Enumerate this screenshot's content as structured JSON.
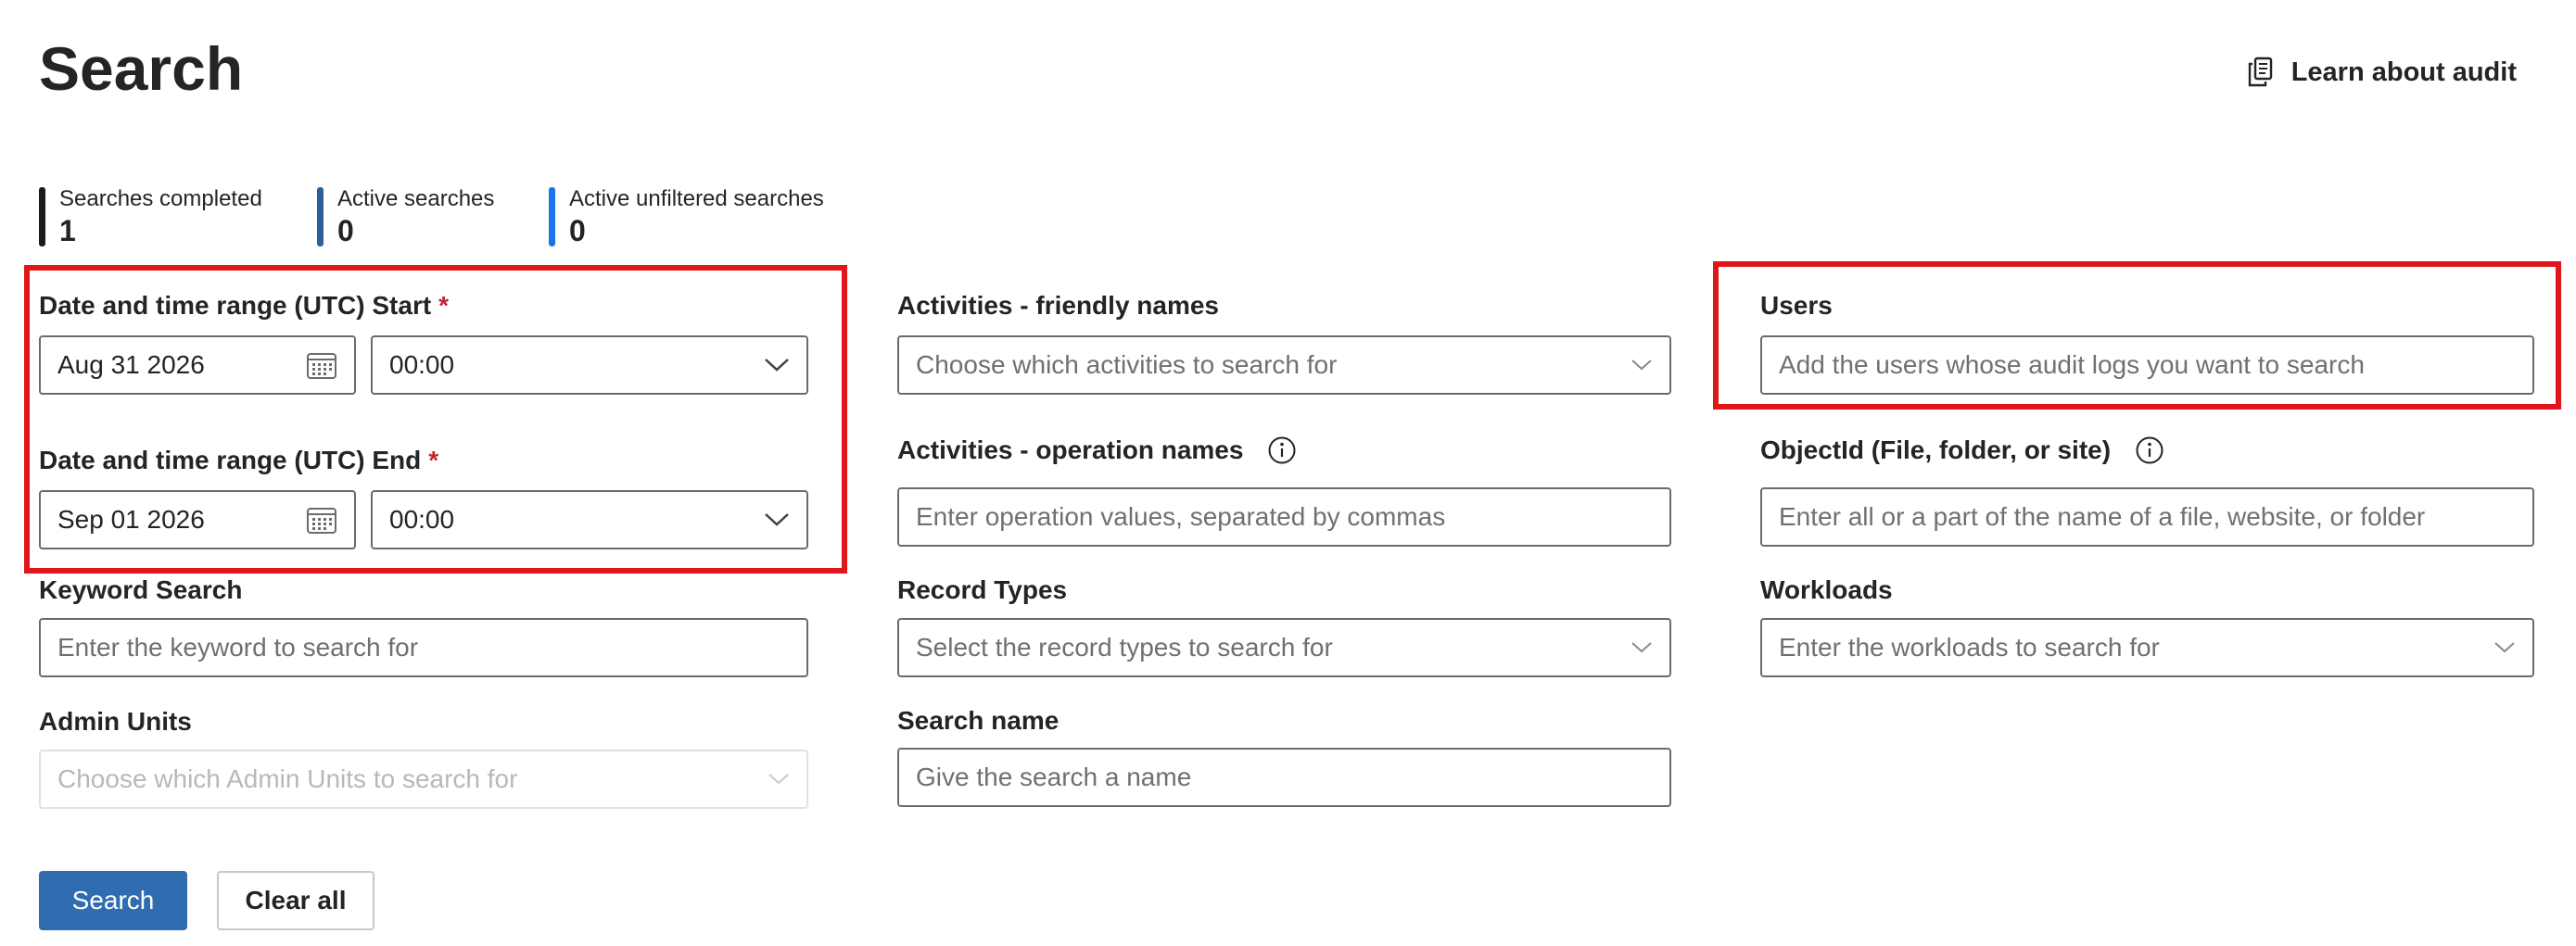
{
  "header": {
    "title": "Search",
    "learn_link": "Learn about audit"
  },
  "stats": [
    {
      "label": "Searches completed",
      "value": "1",
      "color": "#1b1b1b"
    },
    {
      "label": "Active searches",
      "value": "0",
      "color": "#2f5f97"
    },
    {
      "label": "Active unfiltered searches",
      "value": "0",
      "color": "#1a73e8"
    }
  ],
  "form": {
    "start": {
      "label": "Date and time range (UTC) Start",
      "required_mark": "*",
      "date": "Aug 31 2026",
      "time": "00:00"
    },
    "end": {
      "label": "Date and time range (UTC) End",
      "required_mark": "*",
      "date": "Sep 01 2026",
      "time": "00:00"
    },
    "activities_friendly": {
      "label": "Activities - friendly names",
      "placeholder": "Choose which activities to search for"
    },
    "activities_operation": {
      "label": "Activities - operation names",
      "placeholder": "Enter operation values, separated by commas"
    },
    "users": {
      "label": "Users",
      "placeholder": "Add the users whose audit logs you want to search"
    },
    "object_id": {
      "label": "ObjectId (File, folder, or site)",
      "placeholder": "Enter all or a part of the name of a file, website, or folder"
    },
    "keyword": {
      "label": "Keyword Search",
      "placeholder": "Enter the keyword to search for"
    },
    "record_types": {
      "label": "Record Types",
      "placeholder": "Select the record types to search for"
    },
    "workloads": {
      "label": "Workloads",
      "placeholder": "Enter the workloads to search for"
    },
    "admin_units": {
      "label": "Admin Units",
      "placeholder": "Choose which Admin Units to search for"
    },
    "search_name": {
      "label": "Search name",
      "placeholder": "Give the search a name"
    }
  },
  "actions": {
    "search": "Search",
    "clear_all": "Clear all"
  },
  "icons": {
    "calendar": "calendar-icon",
    "chevron": "chevron-down-icon",
    "info": "info-icon",
    "document": "document-copy-icon"
  },
  "colors": {
    "primary": "#2f6db0",
    "highlight": "#e0161b",
    "required": "#c4262e"
  }
}
